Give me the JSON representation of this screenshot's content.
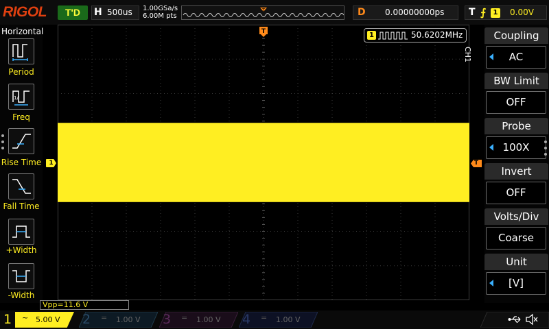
{
  "header": {
    "brand": "RIGOL",
    "run_state": "T'D",
    "horizontal": {
      "letter": "H",
      "timebase": "500us"
    },
    "sample": {
      "rate": "1.00GSa/s",
      "points": "6.00M pts"
    },
    "delay": {
      "letter": "D",
      "value": "0.00000000ps"
    },
    "trigger": {
      "letter": "T",
      "edge_icon": "rising-edge-icon",
      "source": "1",
      "level": "0.00V"
    }
  },
  "left_menu": {
    "title": "Horizontal",
    "items": [
      {
        "label": "Period",
        "icon": "period-measure-icon"
      },
      {
        "label": "Freq",
        "icon": "frequency-measure-icon"
      },
      {
        "label": "Rise Time",
        "icon": "rise-time-icon"
      },
      {
        "label": "Fall Time",
        "icon": "fall-time-icon"
      },
      {
        "label": "+Width",
        "icon": "positive-width-icon"
      },
      {
        "label": "-Width",
        "icon": "negative-width-icon"
      }
    ]
  },
  "display": {
    "frequency_counter": {
      "channel": "1",
      "value": "50.6202MHz",
      "icon": "square-wave-icon"
    },
    "ch1_marker": "1",
    "trigger_marker": "T",
    "trace_color": "#ffee22",
    "waveform": {
      "top_div": 2.85,
      "bottom_div": 5.15
    }
  },
  "right_menu": {
    "channel_label": "CH1",
    "items": [
      {
        "title": "Coupling",
        "value": "AC",
        "has_arrow": true
      },
      {
        "title": "BW Limit",
        "value": "OFF",
        "has_arrow": false
      },
      {
        "title": "Probe",
        "value": "100X",
        "has_arrow": true
      },
      {
        "title": "Invert",
        "value": "OFF",
        "has_arrow": false
      },
      {
        "title": "Volts/Div",
        "value": "Coarse",
        "has_arrow": false
      },
      {
        "title": "Unit",
        "value": "[V]",
        "has_arrow": true
      }
    ]
  },
  "measurement": {
    "vpp": "Vpp=11.6 V"
  },
  "channels": [
    {
      "num": "1",
      "coupling": "~",
      "scale": "5.00 V",
      "color": "#ffee22",
      "active": true
    },
    {
      "num": "2",
      "coupling": "=",
      "scale": "1.00 V",
      "color": "#2aa8ff",
      "active": false
    },
    {
      "num": "3",
      "coupling": "=",
      "scale": "1.00 V",
      "color": "#e020e0",
      "active": false
    },
    {
      "num": "4",
      "coupling": "=",
      "scale": "1.00 V",
      "color": "#3a7aff",
      "active": false
    }
  ],
  "status": {
    "usb_icon": "usb-icon",
    "sound_icon": "speaker-mute-icon"
  }
}
